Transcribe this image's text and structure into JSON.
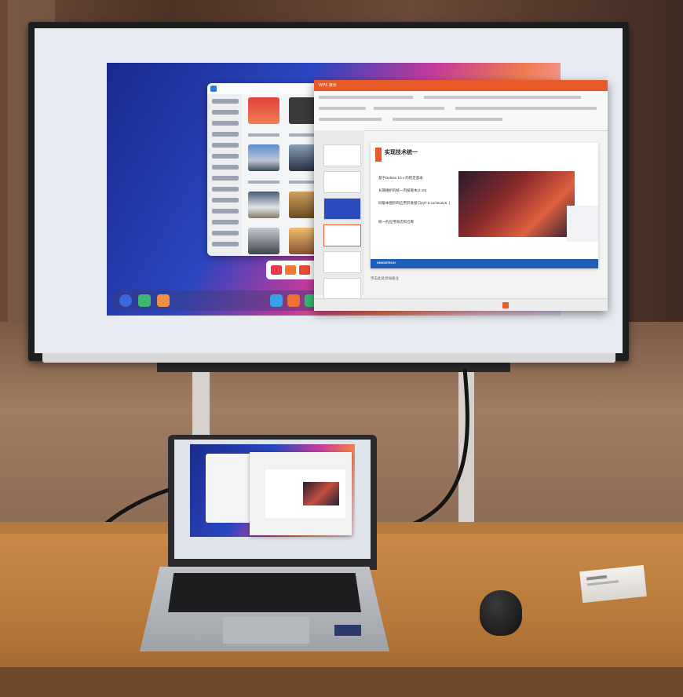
{
  "scene": {
    "description_kind": "photo",
    "monitor": {
      "presentation_window": {
        "tab_label": "WPS 演示",
        "slide_title": "实现技术统一",
        "bullets": [
          "基于Debian 10.x 的稳定基本",
          "长期维护的统一内核版本(4.19)",
          "同版本图形和应用开发接口(QT 5.11/Java15..)",
          "统一的应用商店和仓库"
        ],
        "footer_brand": "UNIONTECH",
        "status_text": "单击此处添加备注"
      }
    },
    "colors": {
      "wallpaper_blue": "#2a46c0",
      "wallpaper_pink": "#c43a9c",
      "wps_accent": "#e85a2a",
      "slide_footer": "#1f5fb8",
      "table_wood": "#c98a48"
    }
  }
}
